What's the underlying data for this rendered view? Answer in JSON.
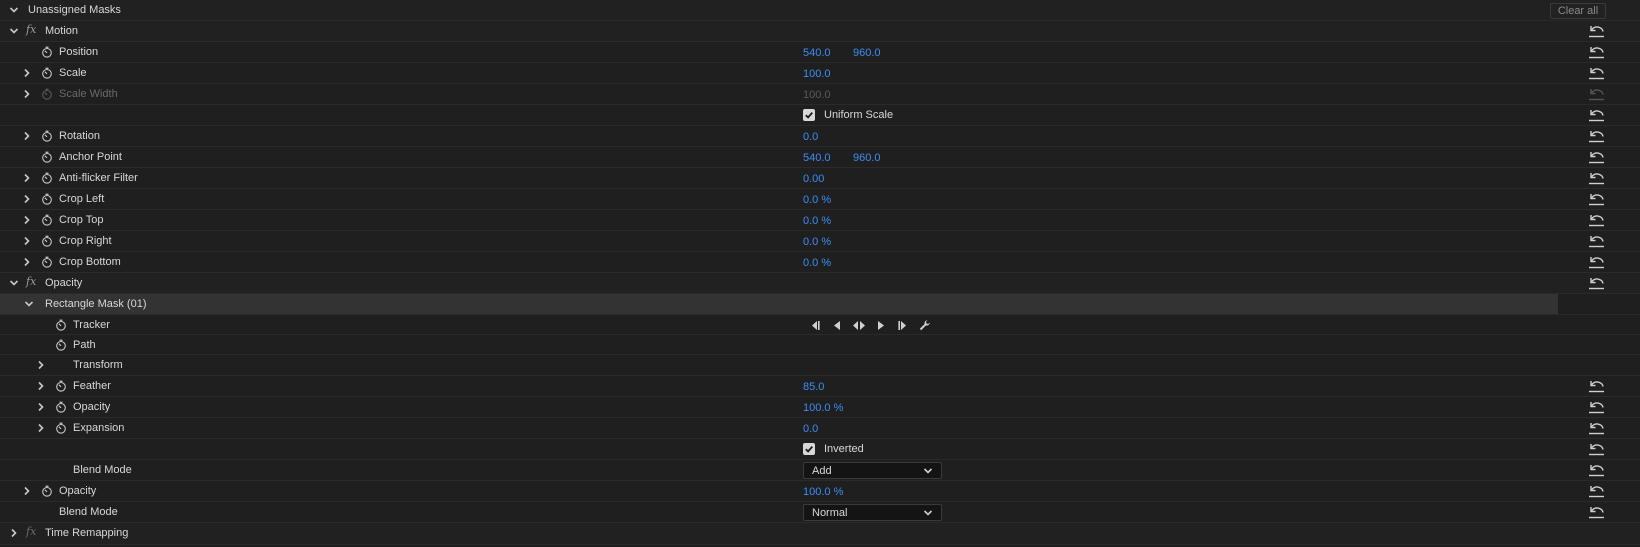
{
  "header": {
    "title": "Unassigned Masks",
    "clear_all": "Clear all"
  },
  "motion": {
    "title": "Motion",
    "position": {
      "label": "Position",
      "x": "540.0",
      "y": "960.0"
    },
    "scale": {
      "label": "Scale",
      "value": "100.0"
    },
    "scale_width": {
      "label": "Scale Width",
      "value": "100.0"
    },
    "uniform_scale": {
      "label": "Uniform Scale",
      "checked": true
    },
    "rotation": {
      "label": "Rotation",
      "value": "0.0"
    },
    "anchor_point": {
      "label": "Anchor Point",
      "x": "540.0",
      "y": "960.0"
    },
    "anti_flicker": {
      "label": "Anti-flicker Filter",
      "value": "0.00"
    },
    "crop_left": {
      "label": "Crop Left",
      "value": "0.0 %"
    },
    "crop_top": {
      "label": "Crop Top",
      "value": "0.0 %"
    },
    "crop_right": {
      "label": "Crop Right",
      "value": "0.0 %"
    },
    "crop_bottom": {
      "label": "Crop Bottom",
      "value": "0.0 %"
    }
  },
  "opacity": {
    "title": "Opacity",
    "mask": {
      "title": "Rectangle Mask (01)",
      "tracker": "Tracker",
      "path": "Path",
      "transform": "Transform",
      "feather": {
        "label": "Feather",
        "value": "85.0"
      },
      "opacity": {
        "label": "Opacity",
        "value": "100.0 %"
      },
      "expansion": {
        "label": "Expansion",
        "value": "0.0"
      },
      "inverted": {
        "label": "Inverted",
        "checked": true
      },
      "blend_mode": {
        "label": "Blend Mode",
        "value": "Add"
      }
    },
    "opacity_prop": {
      "label": "Opacity",
      "value": "100.0 %"
    },
    "blend_mode": {
      "label": "Blend Mode",
      "value": "Normal"
    }
  },
  "time_remapping": {
    "title": "Time Remapping"
  },
  "colors": {
    "value_blue": "#3d8df5",
    "background": "#1d1d1d",
    "accent_purple": "#8a3fd0"
  }
}
